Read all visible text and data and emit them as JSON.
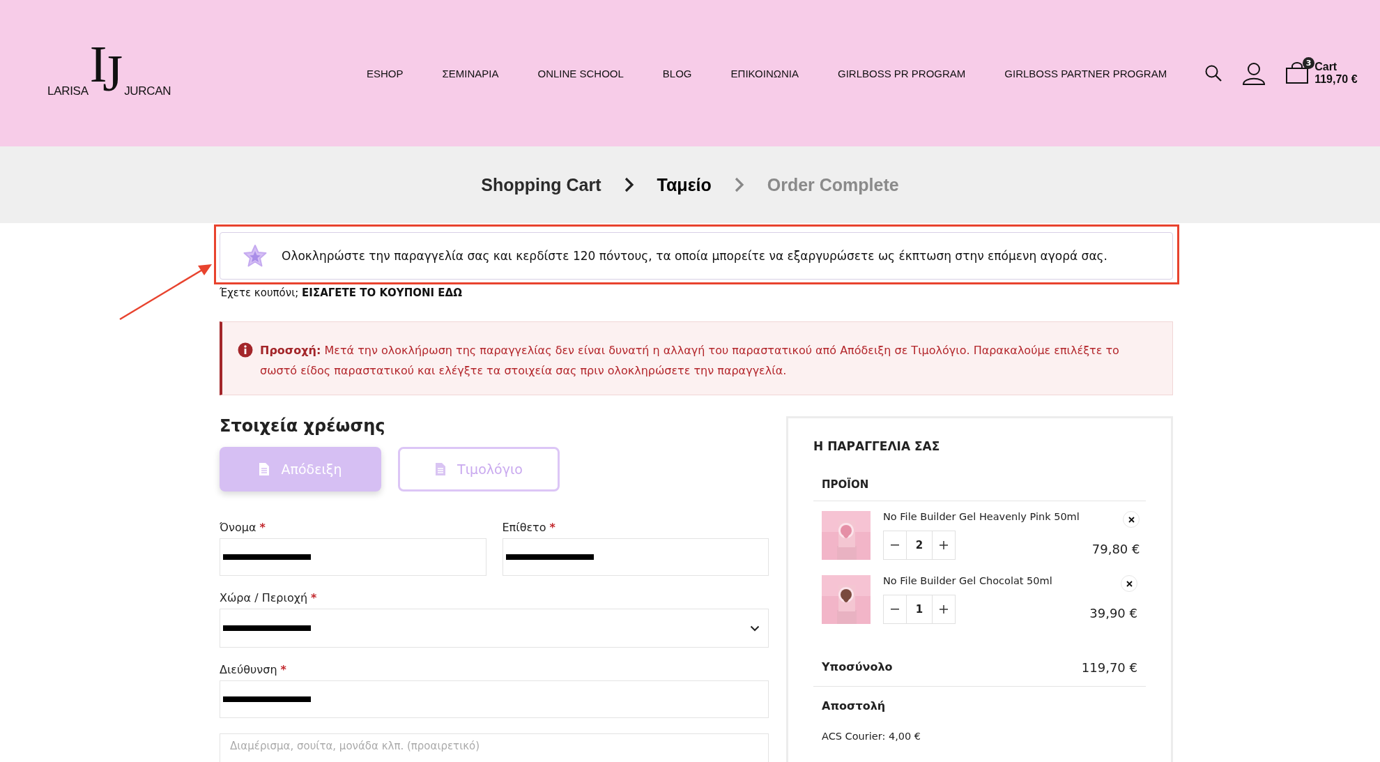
{
  "header": {
    "logo": {
      "first": "LARISA",
      "monogram_1": "I",
      "monogram_2": "J",
      "last": "JURCAN"
    },
    "nav": [
      "ESHOP",
      "ΣΕΜΙΝΑΡΙΑ",
      "ONLINE SCHOOL",
      "BLOG",
      "ΕΠΙΚΟΙΝΩΝΙΑ",
      "GIRLBOSS PR PROGRAM",
      "GIRLBOSS PARTNER PROGRAM"
    ],
    "cart": {
      "count": "3",
      "label": "Cart",
      "total": "119,70 €"
    }
  },
  "breadcrumb": [
    {
      "label": "Shopping Cart",
      "kind": "done"
    },
    {
      "label": "Ταμείο",
      "kind": "current"
    },
    {
      "label": "Order Complete",
      "kind": "pending"
    }
  ],
  "notice": {
    "text": "Ολοκληρώστε την παραγγελία σας και κερδίστε 120 πόντους, τα οποία μπορείτε να εξαργυρώσετε ως έκπτωση στην επόμενη αγορά σας.",
    "highlighted": true
  },
  "coupon": {
    "question": "Έχετε κουπόνι;",
    "link": "ΕΙΣΑΓΕΤΕ ΤΟ ΚΟΥΠΟΝΙ ΕΔΩ"
  },
  "alert": {
    "text": "**Προσοχή:** Μετά την ολοκλήρωση της παραγγελίας δεν είναι δυνατή η αλλαγή του παραστατικού από Απόδειξη σε Τιμολόγιο. Παρακαλούμε επιλέξτε το σωστό είδος παραστατικού και ελέγξτε τα στοιχεία σας πριν ολοκληρώσετε την παραγγελία."
  },
  "billing": {
    "title": "Στοιχεία χρέωσης",
    "doc_types": [
      {
        "label": "Απόδειξη",
        "selected": true
      },
      {
        "label": "Τιμολόγιο",
        "selected": false
      }
    ],
    "rows": [
      [
        {
          "label": "Όνομα",
          "required_mark": "*",
          "kind": "text",
          "redacted": true
        },
        {
          "label": "Επίθετο",
          "required_mark": "*",
          "kind": "text",
          "redacted": true
        }
      ],
      [
        {
          "label": "Χώρα / Περιοχή",
          "required_mark": "*",
          "kind": "select",
          "redacted": true
        }
      ],
      [
        {
          "label": "Διεύθυνση",
          "required_mark": "*",
          "kind": "text",
          "redacted": true
        }
      ],
      [
        {
          "placeholder": "Διαμέρισμα, σουίτα, μονάδα κλπ. (προαιρετικό)",
          "kind": "text"
        }
      ]
    ]
  },
  "order": {
    "title": "Η ΠΑΡΑΓΓΕΛΙΑ ΣΑΣ",
    "column": "ΠΡΟΪΟΝ",
    "items": [
      {
        "name": "No File Builder Gel Heavenly Pink 50ml",
        "qty": "2",
        "price": "79,80 €",
        "color": "#e58fa6"
      },
      {
        "name": "No File Builder Gel Chocolat 50ml",
        "qty": "1",
        "price": "39,90 €",
        "color": "#7a4a3e"
      }
    ],
    "subtotal": {
      "label": "Υποσύνολο",
      "value": "119,70 €"
    },
    "shipping": {
      "label": "Αποστολή",
      "option": "ACS Courier: 4,00 €"
    }
  }
}
